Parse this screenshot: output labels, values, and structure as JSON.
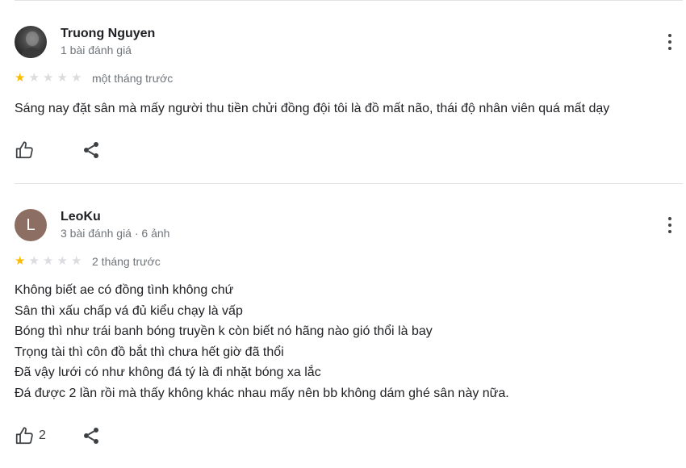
{
  "reviews": [
    {
      "author": "Truong Nguyen",
      "meta": "1 bài đánh giá",
      "rating": 1,
      "date": "một tháng trước",
      "text_lines": [
        "Sáng nay đặt sân mà mấy người thu tiền chửi đồng đội tôi là đồ mất não, thái độ nhân viên quá mất dạy"
      ],
      "likes": ""
    },
    {
      "author": "LeoKu",
      "avatar_letter": "L",
      "meta": "3 bài đánh giá · 6 ảnh",
      "rating": 1,
      "date": "2 tháng trước",
      "text_lines": [
        "Không biết ae có đồng tình không chứ",
        "Sân thì xấu chấp vá đủ kiểu chạy là vấp",
        "Bóng thì như trái banh bóng truyền k còn biết nó hãng nào gió thổi là bay",
        "Trọng tài thì côn đồ bắt thì chưa hết giờ đã thổi",
        "Đã vậy lưới có như không đá tý là đi nhặt bóng xa lắc",
        "Đá được 2 lần rồi mà thấy không khác nhau mấy nên bb không dám ghé sân này nữa."
      ],
      "likes": "2"
    }
  ],
  "colors": {
    "star_on": "#fbbc04",
    "star_off": "#dadce0",
    "avatar_letter_bg": "#8d6e63"
  },
  "icons": {
    "like": "thumb-up-outline-icon",
    "share": "share-icon",
    "more": "more-vert-icon"
  }
}
